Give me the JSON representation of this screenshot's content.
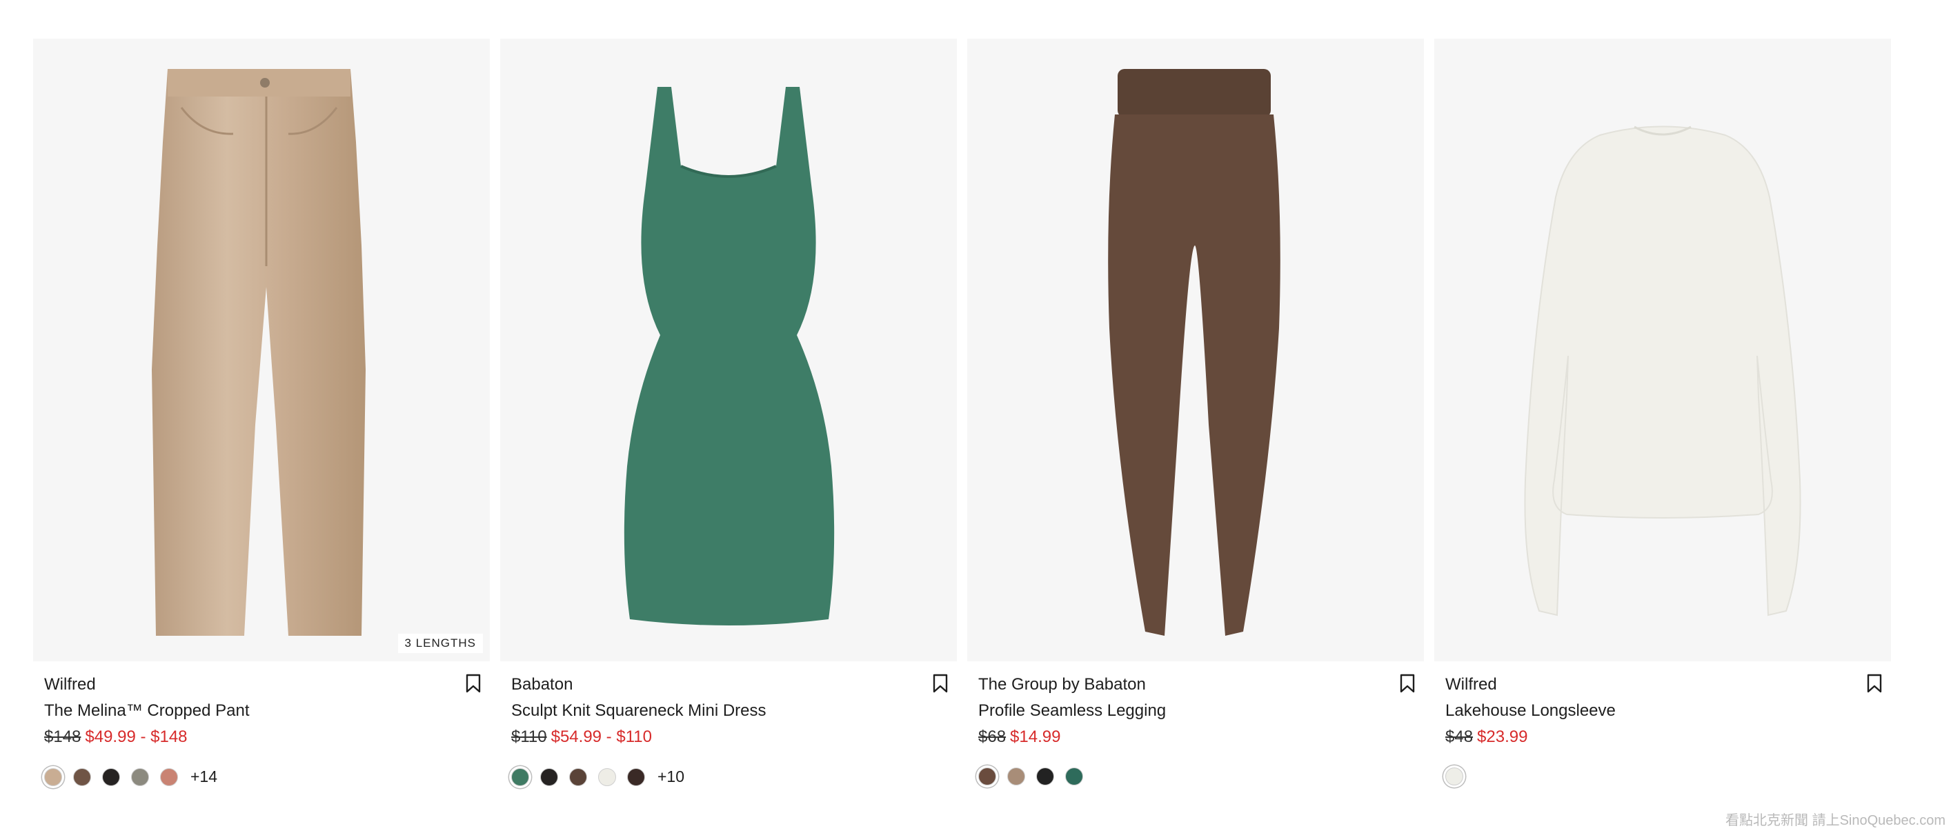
{
  "products": [
    {
      "brand": "Wilfred",
      "name": "The Melina™ Cropped Pant",
      "original_price": "$148",
      "sale_price": "$49.99 - $148",
      "tag": "3 LENGTHS",
      "image_icon": "cropped-pant-image",
      "swatches": [
        "#c9ad93",
        "#6f5445",
        "#262322",
        "#8c8a7f",
        "#c98373"
      ],
      "more_colors": "+14"
    },
    {
      "brand": "Babaton",
      "name": "Sculpt Knit Squareneck Mini Dress",
      "original_price": "$110",
      "sale_price": "$54.99 - $110",
      "tag": "",
      "image_icon": "mini-dress-image",
      "swatches": [
        "#3f7a63",
        "#262322",
        "#5a4338",
        "#eeede6",
        "#3a2a26"
      ],
      "more_colors": "+10"
    },
    {
      "brand": "The Group by Babaton",
      "name": "Profile Seamless Legging",
      "original_price": "$68",
      "sale_price": "$14.99",
      "tag": "",
      "image_icon": "legging-image",
      "swatches": [
        "#6a4c3e",
        "#a88d78",
        "#222222",
        "#2e6b5b"
      ],
      "more_colors": ""
    },
    {
      "brand": "Wilfred",
      "name": "Lakehouse Longsleeve",
      "original_price": "$48",
      "sale_price": "$23.99",
      "tag": "",
      "image_icon": "longsleeve-image",
      "swatches": [
        "#eeeee8"
      ],
      "more_colors": ""
    }
  ],
  "colors": {
    "sale": "#d72b2b",
    "photo_bg": "#f6f6f6"
  },
  "watermark": "看點北克新聞 請上SinoQuebec.com"
}
